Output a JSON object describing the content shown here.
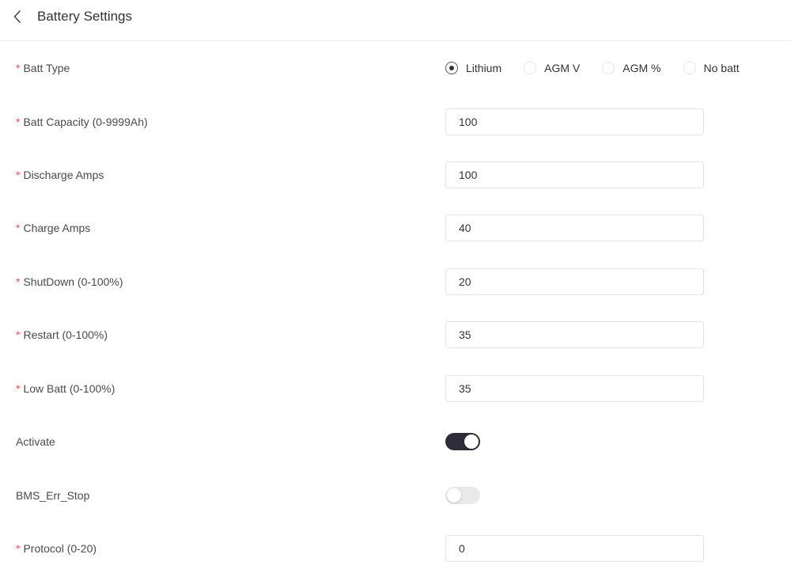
{
  "header": {
    "title": "Battery Settings",
    "back_icon": "chevron-left-icon"
  },
  "batt_type": {
    "label": "Batt Type",
    "required": "*",
    "options": [
      {
        "label": "Lithium",
        "checked": true
      },
      {
        "label": "AGM V",
        "checked": false
      },
      {
        "label": "AGM %",
        "checked": false
      },
      {
        "label": "No batt",
        "checked": false
      }
    ]
  },
  "fields": {
    "batt_capacity": {
      "label": "Batt Capacity (0-9999Ah)",
      "required": "*",
      "value": "100"
    },
    "discharge_amps": {
      "label": "Discharge Amps",
      "required": "*",
      "value": "100"
    },
    "charge_amps": {
      "label": "Charge Amps",
      "required": "*",
      "value": "40"
    },
    "shutdown": {
      "label": "ShutDown (0-100%)",
      "required": "*",
      "value": "20"
    },
    "restart": {
      "label": "Restart (0-100%)",
      "required": "*",
      "value": "35"
    },
    "low_batt": {
      "label": "Low Batt (0-100%)",
      "required": "*",
      "value": "35"
    },
    "protocol": {
      "label": "Protocol (0-20)",
      "required": "*",
      "value": "0"
    }
  },
  "toggles": {
    "activate": {
      "label": "Activate",
      "on": true
    },
    "bms_err_stop": {
      "label": "BMS_Err_Stop",
      "on": false
    }
  },
  "colors": {
    "required": "#ff4d4f",
    "switch_on": "#2e2e3a",
    "switch_off": "#e9e9e9"
  }
}
